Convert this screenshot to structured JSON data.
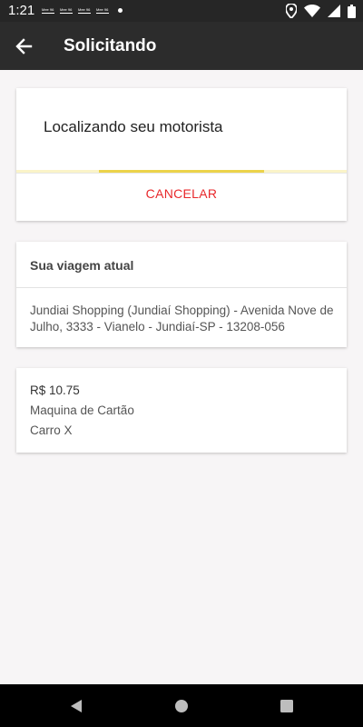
{
  "status_bar": {
    "time": "1:21",
    "notifications": [
      "Mee 96",
      "Mee 96",
      "Mee 96",
      "Mee 96"
    ],
    "icons": [
      "location-icon",
      "wifi-icon",
      "signal-icon",
      "battery-icon"
    ]
  },
  "app_bar": {
    "title": "Solicitando",
    "back_icon": "arrow-left-icon"
  },
  "search_card": {
    "title": "Localizando seu motorista",
    "progress": 0.5,
    "progress_color": "#ecd34a",
    "cancel_label": "CANCELAR",
    "cancel_color": "#e8282b"
  },
  "trip_card": {
    "header": "Sua viagem atual",
    "address": "Jundiai Shopping (Jundiaí Shopping) - Avenida Nove de Julho, 3333 - Vianelo - Jundiaí-SP - 13208-056"
  },
  "payment_card": {
    "price": "R$ 10.75",
    "method": "Maquina de Cartão",
    "car": "Carro X"
  },
  "nav_bar": {
    "buttons": [
      "back-triangle-icon",
      "home-circle-icon",
      "recents-square-icon"
    ]
  }
}
